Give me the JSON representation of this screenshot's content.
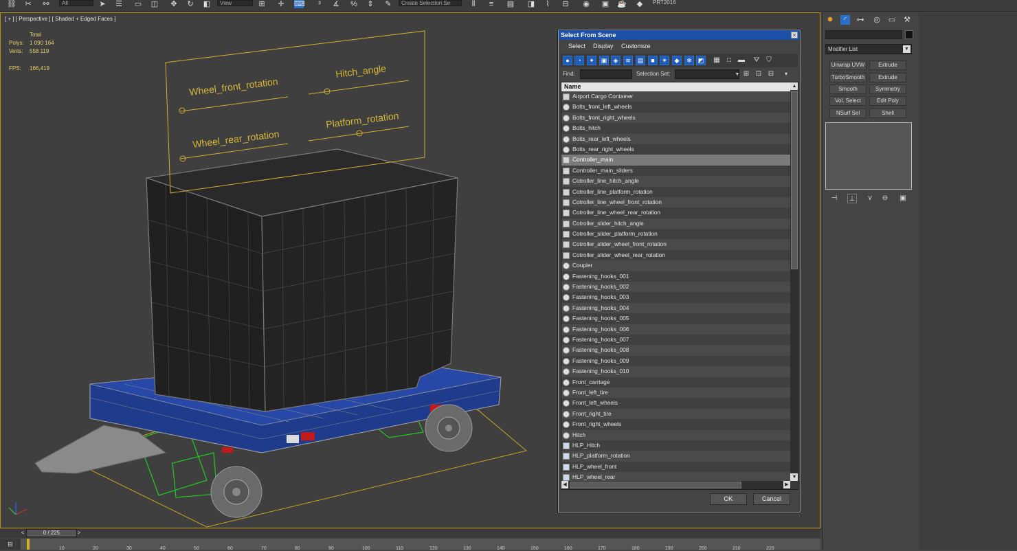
{
  "app": {
    "renderer_label": "PRT2016"
  },
  "toolbar": {
    "icons": [
      "link-icon",
      "unlink-icon",
      "bind-icon",
      "select-icon",
      "select-by-name-icon",
      "rect-region-icon",
      "window-crossing-icon",
      "move-icon",
      "rotate-icon",
      "scale-icon",
      "pivot-icon",
      "select-manipulate-icon",
      "snap-icon",
      "angle-snap-icon",
      "percent-snap-icon",
      "spinner-snap-icon",
      "edit-named-sel-icon",
      "mirror-icon",
      "align-icon",
      "layer-icon",
      "graphite-icon",
      "curve-editor-icon",
      "schematic-icon",
      "material-icon",
      "render-setup-icon",
      "render-frame-icon",
      "render-icon"
    ],
    "selection_filter": "All",
    "reference_coord": "View",
    "named_selection_placeholder": "Create Selection Se"
  },
  "viewport": {
    "label": "[ + ] [ Perspective ] [ Shaded + Edged Faces ]",
    "stats": {
      "total_label": "Total",
      "polys_label": "Polys:",
      "polys_value": "1 090 164",
      "verts_label": "Verts:",
      "verts_value": "558 119",
      "fps_label": "FPS:",
      "fps_value": "166,419"
    },
    "controller_labels": {
      "wheel_front": "Wheel_front_rotation",
      "hitch": "Hitch_angle",
      "wheel_rear": "Wheel_rear_rotation",
      "platform": "Platform_rotation"
    },
    "colors": {
      "border_active": "#b8901c",
      "trailer_blue": "#1f3c8c",
      "wire_grey": "#8a8a8a",
      "helper_green": "#22cc22",
      "slider_gold": "#d4b030"
    }
  },
  "dialog": {
    "title": "Select From Scene",
    "close": "×",
    "menu": [
      "Select",
      "Display",
      "Customize"
    ],
    "find_label": "Find:",
    "find_value": "",
    "selection_set_label": "Selection Set:",
    "selection_set_value": "",
    "column_name": "Name",
    "ok": "OK",
    "cancel": "Cancel",
    "items": [
      {
        "name": "Airport Cargo Container",
        "type": "group"
      },
      {
        "name": "Bolts_front_left_wheels",
        "type": "geometry"
      },
      {
        "name": "Bolts_front_right_wheels",
        "type": "geometry"
      },
      {
        "name": "Bolts_hitch",
        "type": "geometry"
      },
      {
        "name": "Bolts_rear_left_wheels",
        "type": "geometry"
      },
      {
        "name": "Bolts_rear_right_wheels",
        "type": "geometry"
      },
      {
        "name": "Controller_main",
        "type": "shape",
        "selected": true
      },
      {
        "name": "Controller_main_sliders",
        "type": "shape"
      },
      {
        "name": "Cotroller_line_hitch_angle",
        "type": "shape"
      },
      {
        "name": "Cotroller_line_platform_rotation",
        "type": "shape"
      },
      {
        "name": "Cotroller_line_wheel_front_rotation",
        "type": "shape"
      },
      {
        "name": "Cotroller_line_wheel_rear_rotation",
        "type": "shape"
      },
      {
        "name": "Cotroller_slider_hitch_angle",
        "type": "shape"
      },
      {
        "name": "Cotroller_slider_platform_rotation",
        "type": "shape"
      },
      {
        "name": "Cotroller_slider_wheel_front_rotation",
        "type": "shape"
      },
      {
        "name": "Cotroller_slider_wheel_rear_rotation",
        "type": "shape"
      },
      {
        "name": "Coupler",
        "type": "geometry"
      },
      {
        "name": "Fastening_hooks_001",
        "type": "geometry"
      },
      {
        "name": "Fastening_hooks_002",
        "type": "geometry"
      },
      {
        "name": "Fastening_hooks_003",
        "type": "geometry"
      },
      {
        "name": "Fastening_hooks_004",
        "type": "geometry"
      },
      {
        "name": "Fastening_hooks_005",
        "type": "geometry"
      },
      {
        "name": "Fastening_hooks_006",
        "type": "geometry"
      },
      {
        "name": "Fastening_hooks_007",
        "type": "geometry"
      },
      {
        "name": "Fastening_hooks_008",
        "type": "geometry"
      },
      {
        "name": "Fastening_hooks_009",
        "type": "geometry"
      },
      {
        "name": "Fastening_hooks_010",
        "type": "geometry"
      },
      {
        "name": "Front_carriage",
        "type": "geometry"
      },
      {
        "name": "Front_left_tire",
        "type": "geometry"
      },
      {
        "name": "Front_left_wheels",
        "type": "geometry"
      },
      {
        "name": "Front_right_tire",
        "type": "geometry"
      },
      {
        "name": "Front_right_wheels",
        "type": "geometry"
      },
      {
        "name": "Hitch",
        "type": "geometry"
      },
      {
        "name": "HLP_Hitch",
        "type": "helper"
      },
      {
        "name": "HLP_platform_rotation",
        "type": "helper"
      },
      {
        "name": "HLP_wheel_front",
        "type": "helper"
      },
      {
        "name": "HLP_wheel_rear",
        "type": "helper"
      }
    ]
  },
  "command_panel": {
    "modifier_list": "Modifier List",
    "buttons": [
      "Unwrap UVW",
      "Extrude",
      "TurboSmooth",
      "Symmetry",
      "Smooth",
      "Symmetry",
      "Vol. Select",
      "Edit Poly",
      "NSurf Sel",
      "Shell"
    ],
    "visible_buttons": [
      [
        "Unwrap UVW",
        "Extrude"
      ],
      [
        "TurboSmooth",
        "Extrude"
      ],
      [
        "Smooth",
        "Symmetry"
      ],
      [
        "Vol. Select",
        "Edit Poly"
      ],
      [
        "NSurf Sel",
        "Shell"
      ]
    ]
  },
  "timeline": {
    "frame_display": "0 / 225",
    "ticks": [
      "10",
      "20",
      "30",
      "40",
      "50",
      "60",
      "70",
      "80",
      "90",
      "100",
      "110",
      "120",
      "130",
      "140",
      "150",
      "160",
      "170",
      "180",
      "190",
      "200",
      "210",
      "220"
    ]
  }
}
